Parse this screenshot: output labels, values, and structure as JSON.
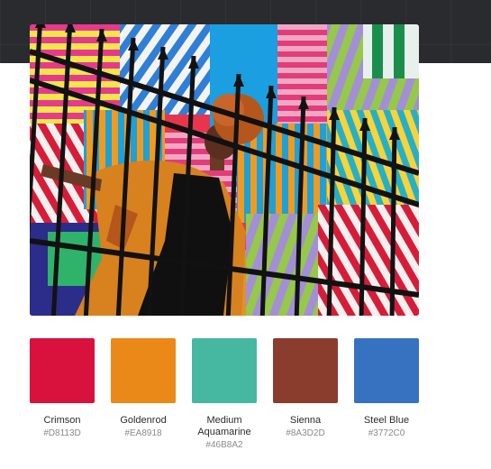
{
  "photo": {
    "icon": "photo-mural-woman-image"
  },
  "palette": [
    {
      "name": "Crimson",
      "hex": "#D8113D",
      "color": "#D8113D"
    },
    {
      "name": "Goldenrod",
      "hex": "#EA8918",
      "color": "#EA8918"
    },
    {
      "name": "Medium Aquamarine",
      "hex": "#46B8A2",
      "color": "#46B8A2"
    },
    {
      "name": "Sienna",
      "hex": "#8A3D2D",
      "color": "#8A3D2D"
    },
    {
      "name": "Steel Blue",
      "hex": "#3772C0",
      "color": "#3772C0"
    }
  ]
}
